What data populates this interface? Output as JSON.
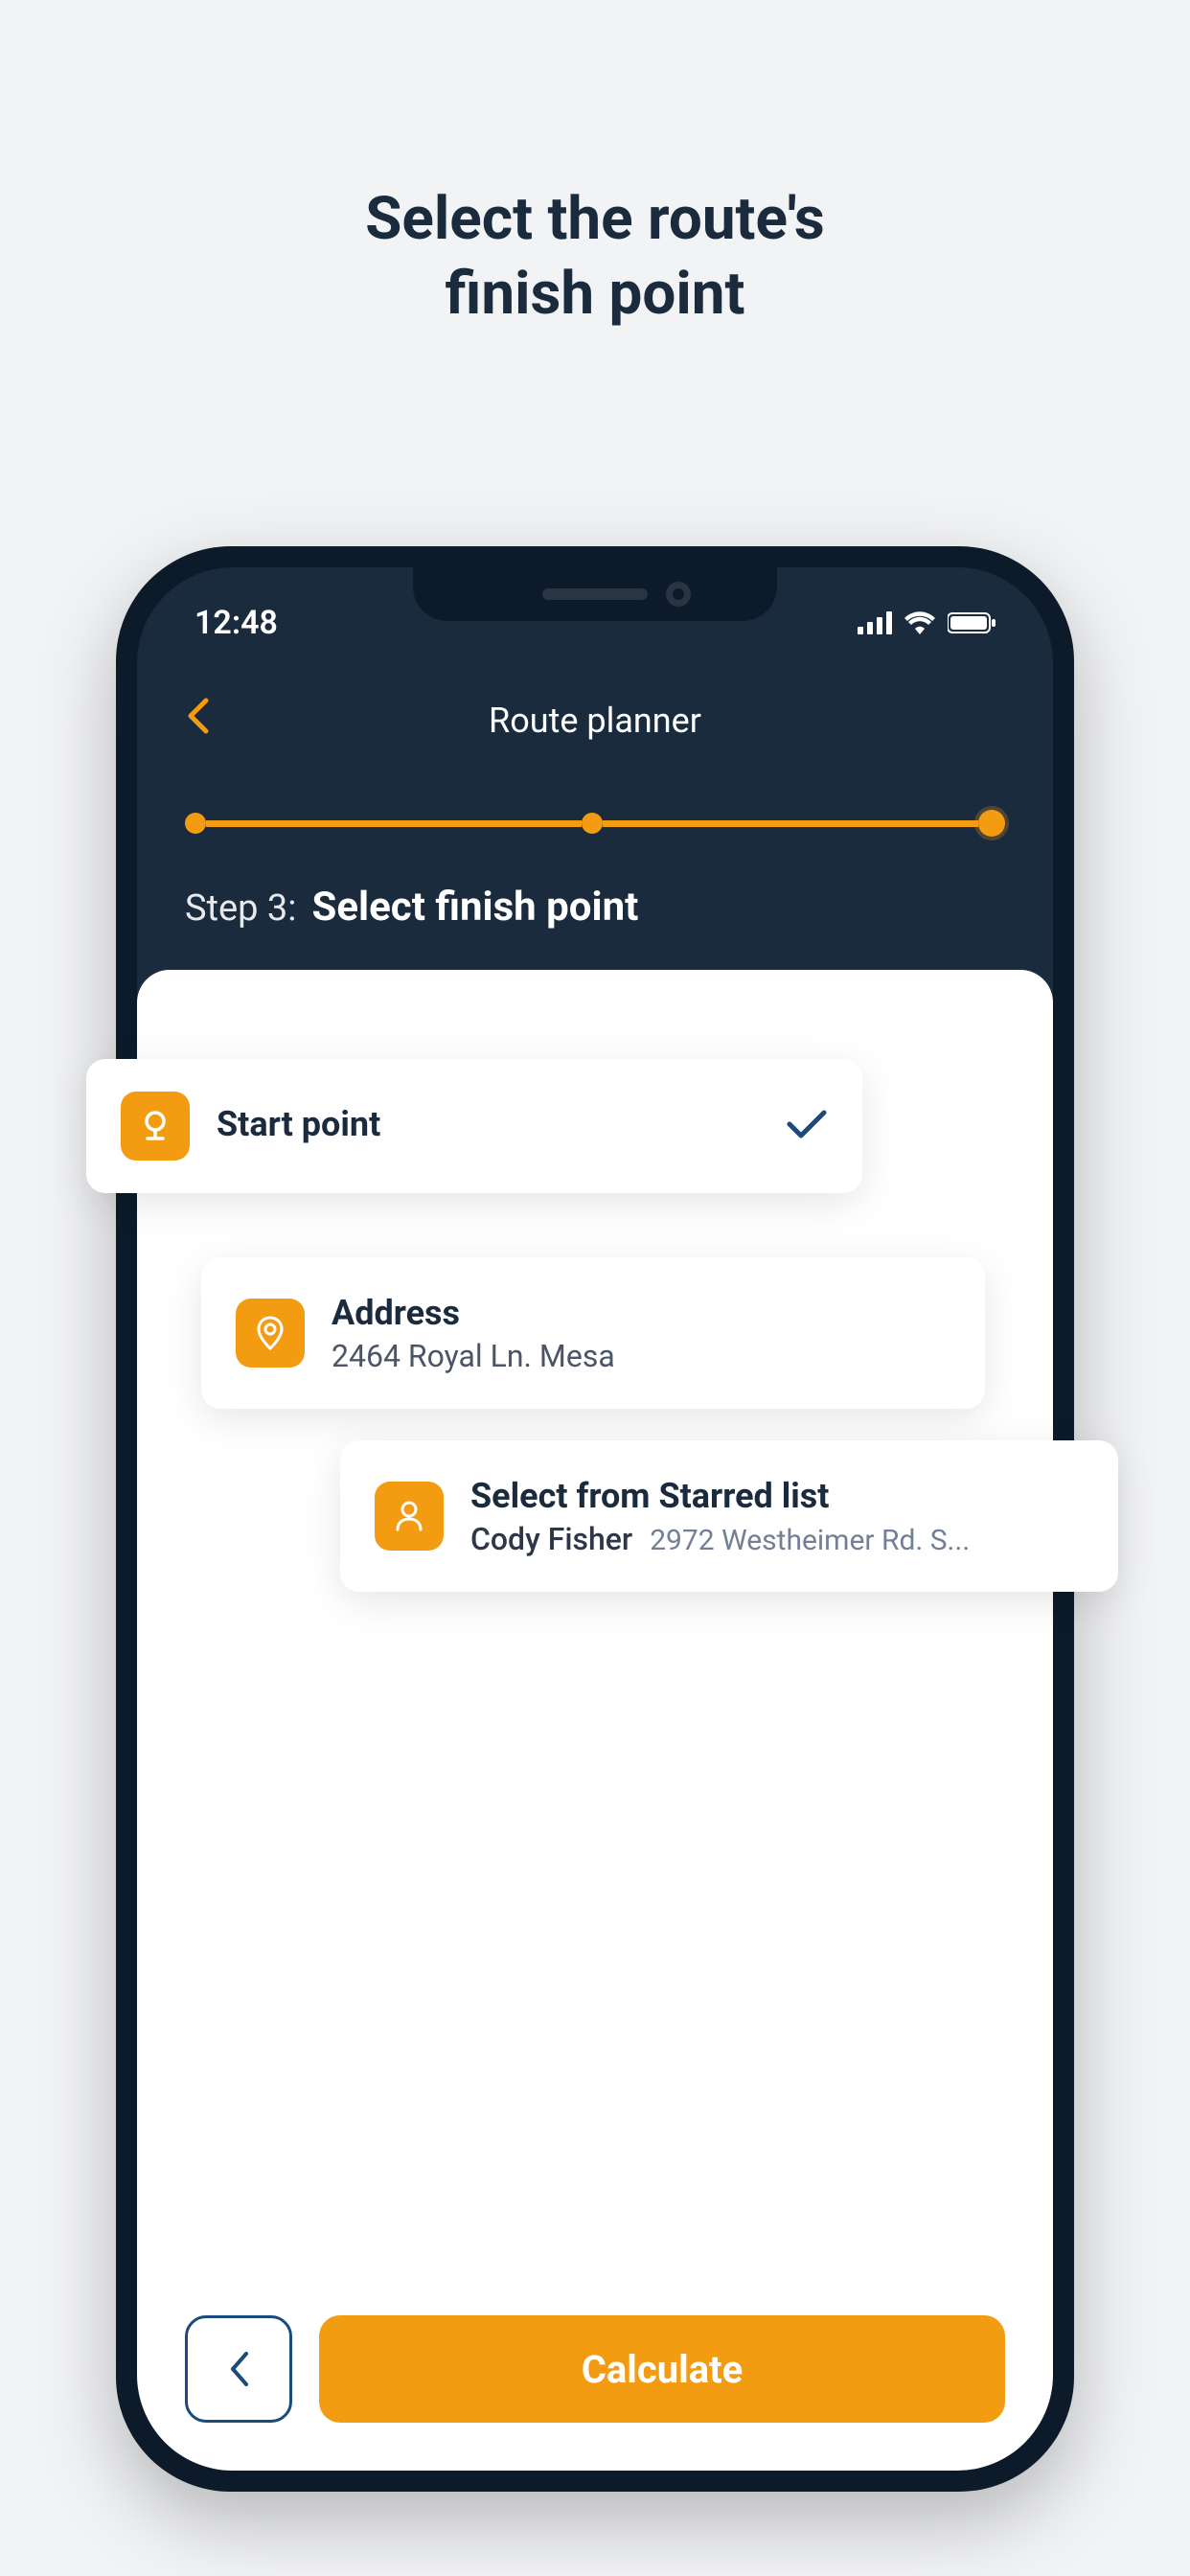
{
  "page": {
    "title_line1": "Select the route's",
    "title_line2": "finish point"
  },
  "statusBar": {
    "time": "12:48"
  },
  "header": {
    "title": "Route planner"
  },
  "step": {
    "number": "Step 3:",
    "text": "Select finish point"
  },
  "cards": {
    "start": {
      "title": "Start point"
    },
    "address": {
      "title": "Address",
      "subtitle": "2464 Royal Ln. Mesa"
    },
    "starred": {
      "title": "Select from Starred list",
      "name": "Cody Fisher",
      "address": "2972 Westheimer Rd. S..."
    }
  },
  "buttons": {
    "calculate": "Calculate"
  },
  "colors": {
    "accent": "#f39c12",
    "dark": "#1a2b3e",
    "background": "#f2f3f5"
  }
}
